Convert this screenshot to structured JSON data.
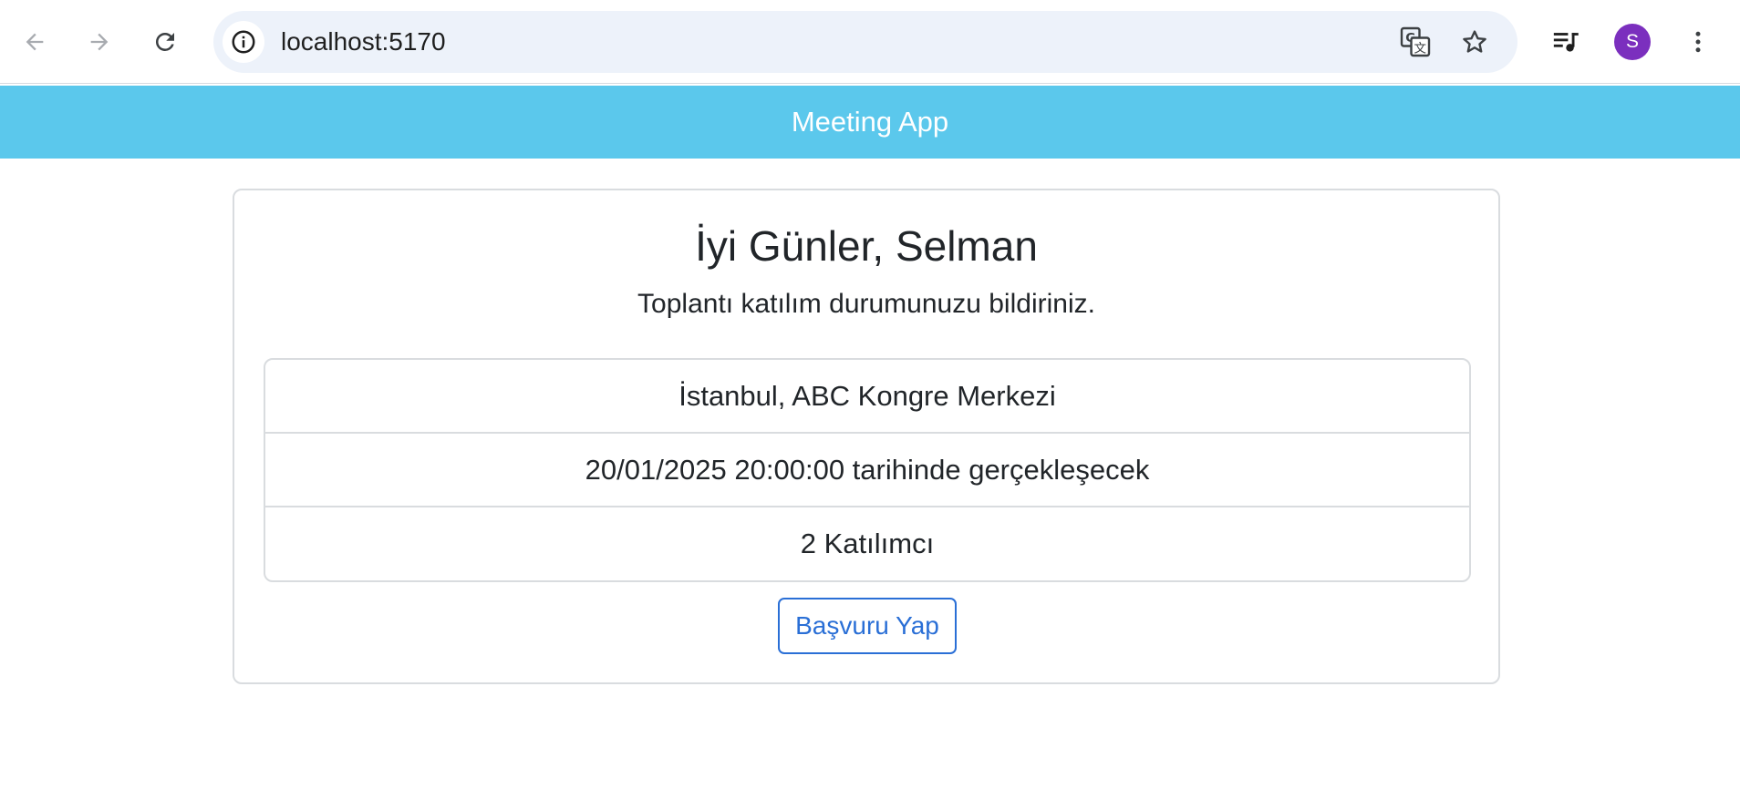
{
  "browser": {
    "url": "localhost:5170",
    "profile_initial": "S",
    "profile_color": "#7b2fbe",
    "icons": {
      "back": "back-arrow-icon",
      "forward": "forward-arrow-icon",
      "reload": "reload-icon",
      "site_info": "info-icon",
      "translate": "translate-icon",
      "bookmark": "star-icon",
      "media": "media-queue-icon",
      "menu": "kebab-menu-icon"
    }
  },
  "app": {
    "title": "Meeting App",
    "header_color": "#5bc8ec"
  },
  "meeting": {
    "greeting": "İyi Günler, Selman",
    "subtitle": "Toplantı katılım durumunuzu bildiriniz.",
    "location": "İstanbul, ABC Kongre Merkezi",
    "datetime": "20/01/2025 20:00:00 tarihinde gerçekleşecek",
    "participants": "2 Katılımcı",
    "apply_label": "Başvuru Yap",
    "accent_color": "#2a6fd6"
  }
}
